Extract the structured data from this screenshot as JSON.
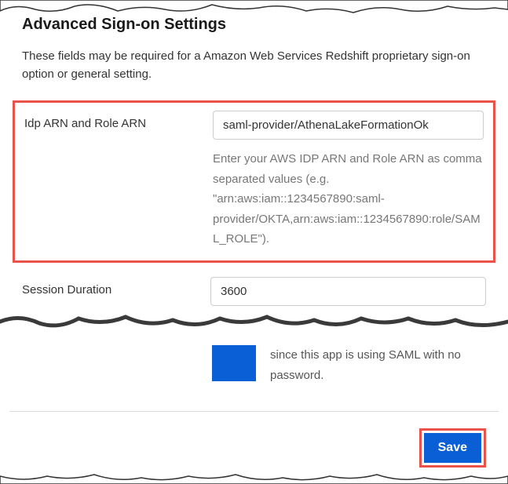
{
  "heading": "Advanced Sign-on Settings",
  "description": "These fields may be required for a Amazon Web Services Redshift proprietary sign-on option or general setting.",
  "idp": {
    "label": "Idp ARN and Role ARN",
    "value": "saml-provider/AthenaLakeFormationOk",
    "help": "Enter your AWS IDP ARN and Role ARN as comma separated values (e.g. \"arn:aws:iam::1234567890:saml-provider/OKTA,arn:aws:iam::1234567890:role/SAML_ROLE\")."
  },
  "session": {
    "label": "Session Duration",
    "value": "3600"
  },
  "note_text": "since this app is using SAML with no password.",
  "save_label": "Save"
}
